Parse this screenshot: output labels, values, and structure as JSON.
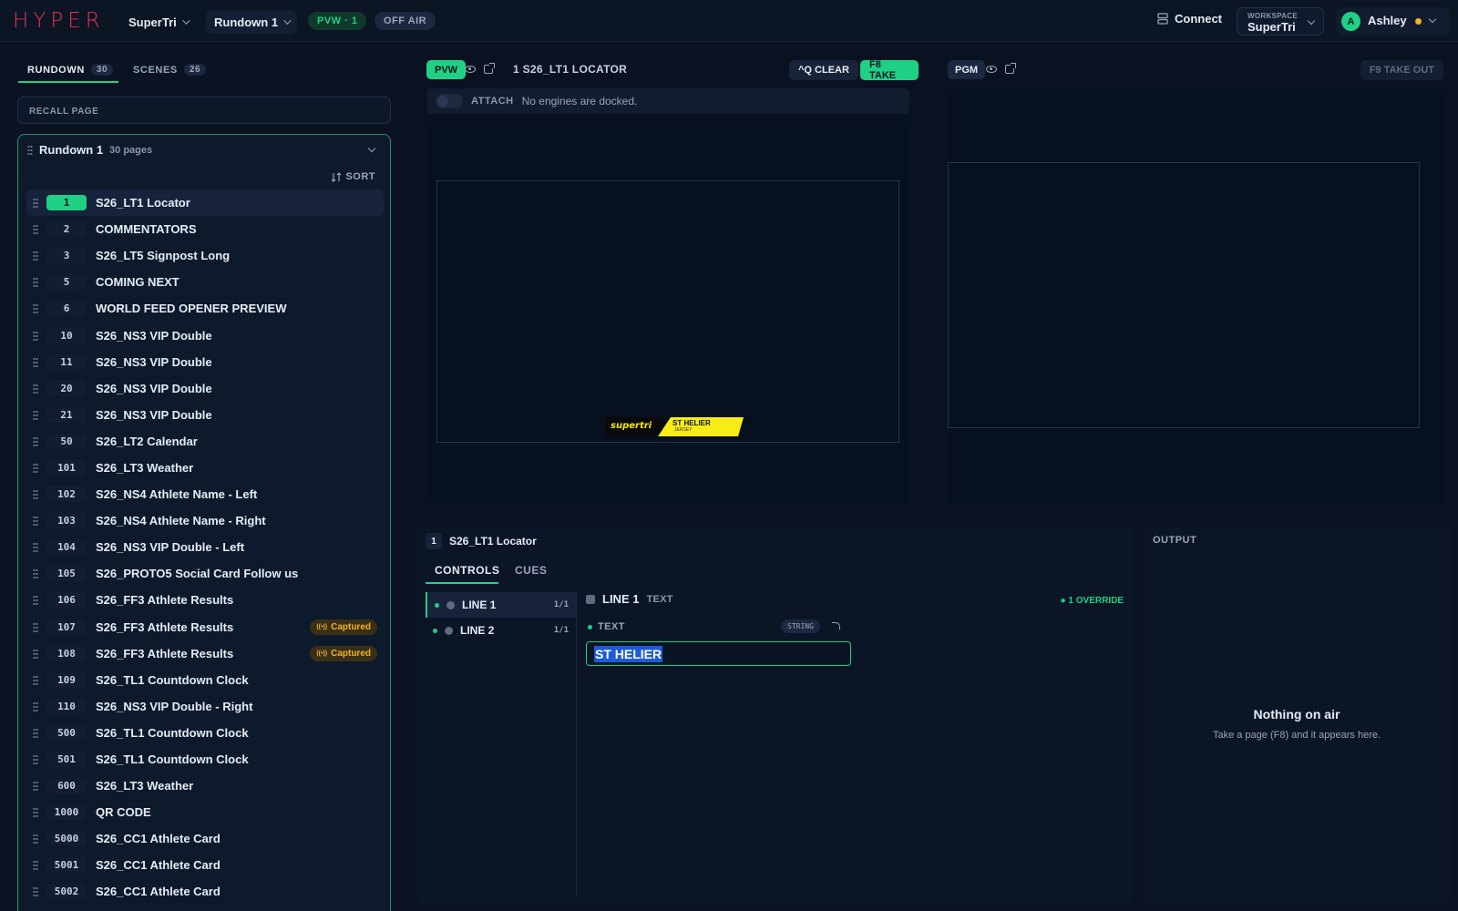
{
  "topbar": {
    "logo": "HYPER",
    "project": "SuperTri",
    "rundown": "Rundown 1",
    "pvw_pill": "PVW · 1",
    "air_pill": "OFF AIR",
    "connect": "Connect",
    "workspace_label": "WORKSPACE",
    "workspace_value": "SuperTri",
    "user_initial": "A",
    "user_name": "Ashley"
  },
  "sidebar": {
    "tabs": [
      {
        "label": "RUNDOWN",
        "count": "30"
      },
      {
        "label": "SCENES",
        "count": "26"
      }
    ],
    "recall_placeholder": "RECALL PAGE",
    "rundown_title": "Rundown 1",
    "rundown_pages": "30 pages",
    "sort_label": "SORT",
    "captured_label": "Captured",
    "pages": [
      {
        "num": "1",
        "name": "S26_LT1 Locator"
      },
      {
        "num": "2",
        "name": "COMMENTATORS"
      },
      {
        "num": "3",
        "name": "S26_LT5 Signpost Long"
      },
      {
        "num": "5",
        "name": "COMING NEXT"
      },
      {
        "num": "6",
        "name": "WORLD FEED OPENER PREVIEW"
      },
      {
        "num": "10",
        "name": "S26_NS3 VIP Double"
      },
      {
        "num": "11",
        "name": "S26_NS3 VIP Double"
      },
      {
        "num": "20",
        "name": "S26_NS3 VIP Double"
      },
      {
        "num": "21",
        "name": "S26_NS3 VIP Double"
      },
      {
        "num": "50",
        "name": "S26_LT2 Calendar"
      },
      {
        "num": "101",
        "name": "S26_LT3 Weather"
      },
      {
        "num": "102",
        "name": "S26_NS4 Athlete Name - Left"
      },
      {
        "num": "103",
        "name": "S26_NS4 Athlete Name - Right"
      },
      {
        "num": "104",
        "name": "S26_NS3 VIP Double - Left"
      },
      {
        "num": "105",
        "name": "S26_PROTO5 Social Card Follow us"
      },
      {
        "num": "106",
        "name": "S26_FF3 Athlete Results"
      },
      {
        "num": "107",
        "name": "S26_FF3 Athlete Results"
      },
      {
        "num": "108",
        "name": "S26_FF3 Athlete Results"
      },
      {
        "num": "109",
        "name": "S26_TL1 Countdown Clock"
      },
      {
        "num": "110",
        "name": "S26_NS3 VIP Double - Right"
      },
      {
        "num": "500",
        "name": "S26_TL1 Countdown Clock"
      },
      {
        "num": "501",
        "name": "S26_TL1 Countdown Clock"
      },
      {
        "num": "600",
        "name": "S26_LT3 Weather"
      },
      {
        "num": "1000",
        "name": "QR CODE"
      },
      {
        "num": "5000",
        "name": "S26_CC1 Athlete Card"
      },
      {
        "num": "5001",
        "name": "S26_CC1 Athlete Card"
      },
      {
        "num": "5002",
        "name": "S26_CC1 Athlete Card"
      }
    ]
  },
  "preview": {
    "badge": "PVW",
    "title": "1 S26_LT1 LOCATOR",
    "clear_label": "^Q CLEAR",
    "take_label": "F8 TAKE",
    "attach_label": "ATTACH",
    "attach_message": "No engines are docked.",
    "graphic_brand": "supertri",
    "graphic_name": "ST HELIER",
    "graphic_sub": "JERSEY"
  },
  "program": {
    "badge": "PGM",
    "takeout_label": "F9 TAKE OUT"
  },
  "editor": {
    "page_num": "1",
    "page_title": "S26_LT1 Locator",
    "tabs": [
      "CONTROLS",
      "CUES"
    ],
    "lines": [
      {
        "label": "LINE 1",
        "frac": "1/1"
      },
      {
        "label": "LINE 2",
        "frac": "1/1"
      }
    ],
    "field_name": "LINE 1",
    "field_type": "TEXT",
    "override_label": "● 1 OVERRIDE",
    "sub_label": "TEXT",
    "string_chip": "STRING",
    "text_value": "ST HELIER"
  },
  "output": {
    "label": "OUTPUT",
    "empty_title": "Nothing on air",
    "empty_sub": "Take a page (F8) and it appears here."
  },
  "colors": {
    "accent": "#1fd185",
    "logo": "#e0344f",
    "captured": "#f0b429",
    "background": "#0b1322"
  }
}
